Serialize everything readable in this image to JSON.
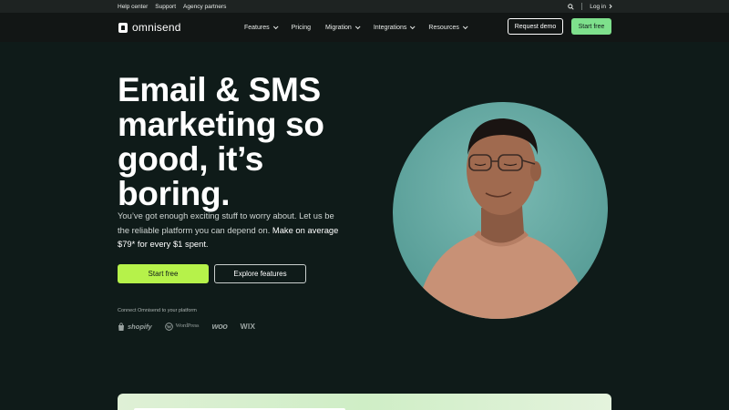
{
  "utility": {
    "help_center": "Help center",
    "support": "Support",
    "agency_partners": "Agency partners",
    "search_icon": "search-icon",
    "login": "Log in"
  },
  "nav": {
    "brand": "omnisend",
    "items": [
      {
        "label": "Features",
        "dropdown": true
      },
      {
        "label": "Pricing",
        "dropdown": false
      },
      {
        "label": "Migration",
        "dropdown": true
      },
      {
        "label": "Integrations",
        "dropdown": true
      },
      {
        "label": "Resources",
        "dropdown": true
      }
    ],
    "request_demo": "Request demo",
    "start_free": "Start free"
  },
  "hero": {
    "title": "Email & SMS marketing so good, it’s boring.",
    "desc_plain": "You’ve got enough exciting stuff to worry about. Let us be the reliable platform you can depend on. ",
    "desc_strong": "Make on average $79* for every $1 spent.",
    "cta_primary": "Start free",
    "cta_secondary": "Explore features",
    "connect_label": "Connect Omnisend to your platform",
    "platforms": [
      "shopify",
      "WordPress",
      "woo",
      "WIX"
    ]
  },
  "colors": {
    "background": "#0f1b19",
    "accent_lime": "#b6f24a",
    "accent_green": "#7ee08c",
    "image_bg": "#5fa6a0",
    "card_gradient": "#cfeec6"
  }
}
